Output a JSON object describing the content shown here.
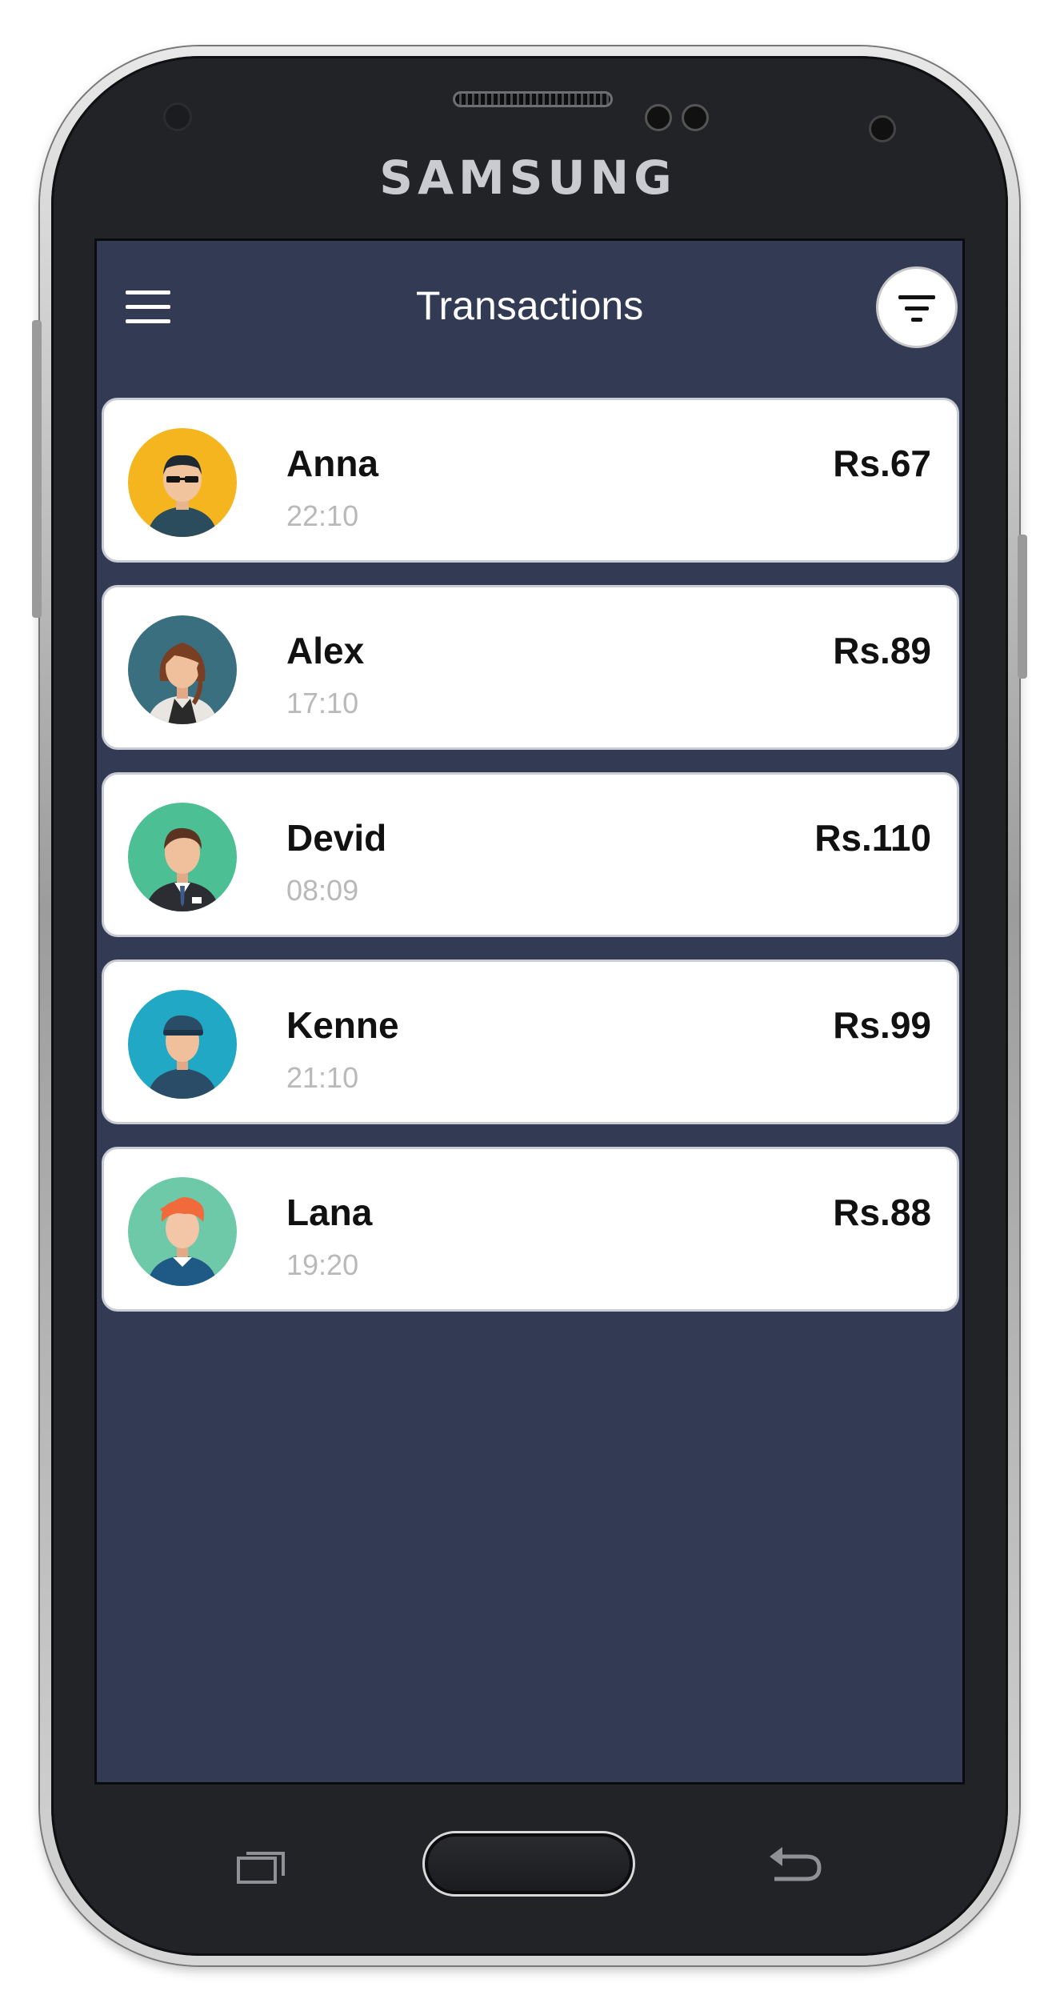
{
  "device": {
    "brand": "SAMSUNG"
  },
  "header": {
    "title": "Transactions"
  },
  "transactions": [
    {
      "name": "Anna",
      "time": "22:10",
      "amount": "Rs.67",
      "avatar_color": "#f5b51e"
    },
    {
      "name": "Alex",
      "time": "17:10",
      "amount": "Rs.89",
      "avatar_color": "#3a6f80"
    },
    {
      "name": "Devid",
      "time": "08:09",
      "amount": "Rs.110",
      "avatar_color": "#4cbf94"
    },
    {
      "name": "Kenne",
      "time": "21:10",
      "amount": "Rs.99",
      "avatar_color": "#20a8c4"
    },
    {
      "name": "Lana",
      "time": "19:20",
      "amount": "Rs.88",
      "avatar_color": "#6dc9a8"
    }
  ],
  "colors": {
    "screen_bg": "#333a54",
    "card_bg": "#ffffff",
    "time_text": "#b9b9b9"
  },
  "icons": {
    "menu": "hamburger-icon",
    "filter": "filter-icon",
    "recent": "recent-apps-icon",
    "back": "back-icon"
  }
}
